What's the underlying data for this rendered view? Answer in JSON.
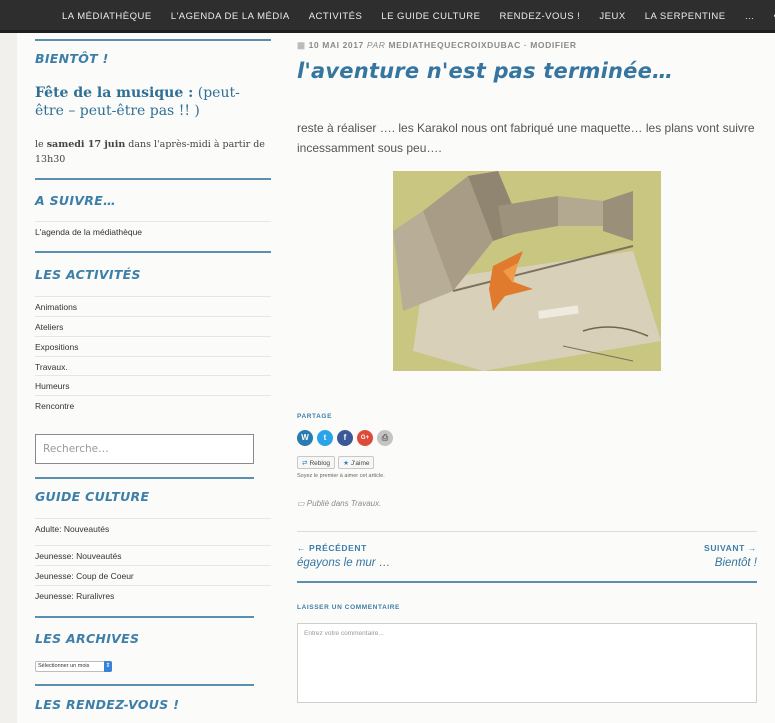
{
  "nav": {
    "items": [
      "LA MÉDIATHÈQUE",
      "L'AGENDA DE LA MÉDIA",
      "ACTIVITÉS",
      "LE GUIDE CULTURE",
      "RENDEZ-VOUS !",
      "JEUX",
      "LA SERPENTINE",
      "…",
      "•••"
    ]
  },
  "sidebar": {
    "bientot": {
      "title": "BIENTÔT !",
      "event_name": "Fête de la musique :",
      "event_rest": " (peut-être – peut-être pas !! )",
      "date_prefix": "le ",
      "date_day": "samedi 17 juin",
      "date_rest": " dans l'après-midi à partir de 13h30"
    },
    "a_suivre": {
      "title": "A SUIVRE…",
      "items": [
        "L'agenda de la médiathèque"
      ]
    },
    "activites": {
      "title": "LES ACTIVITÉS",
      "items": [
        "Animations",
        "Ateliers",
        "Expositions",
        "Travaux.",
        "Humeurs",
        "Rencontre"
      ]
    },
    "search": {
      "placeholder": "Recherche…"
    },
    "guide": {
      "title": "GUIDE CULTURE",
      "items": [
        "Adulte: Nouveautés",
        "Jeunesse: Nouveautés",
        "Jeunesse: Coup de Coeur",
        "Jeunesse: Ruralivres"
      ]
    },
    "archives": {
      "title": "LES ARCHIVES",
      "select": "Sélectionner un mois"
    },
    "rdv": {
      "title": "LES RENDEZ-VOUS !"
    }
  },
  "post": {
    "date": "10 MAI 2017",
    "par": "PAR",
    "author": "MEDIATHEQUECROIXDUBAC",
    "sep": "·",
    "modify": "MODIFIER",
    "title": "l'aventure n'est pas terminée…",
    "body": "reste à réaliser …. les Karakol nous ont fabriqué une maquette… les plans vont suivre incessamment sous peu….",
    "share_label": "PARTAGE",
    "reblog": "Reblog",
    "like": "J'aime",
    "like_note": "Soyez le premier à aimer cet article.",
    "posted_prefix": "Publié dans ",
    "posted_cat": "Travaux.",
    "prev_label": "← PRÉCÉDENT",
    "prev_title": "égayons le mur …",
    "next_label": "SUIVANT →",
    "next_title": "Bientôt !",
    "comment_label": "LAISSER UN COMMENTAIRE",
    "comment_placeholder": "Entrez votre commentaire..."
  },
  "colors": {
    "accent": "#3d7fa8",
    "nav_bg": "#2e2e2e",
    "wordpress": "#2a7bb0",
    "twitter": "#2aa3e8",
    "facebook": "#3b5998",
    "google": "#dd4b39",
    "print": "#b0b0b0"
  }
}
